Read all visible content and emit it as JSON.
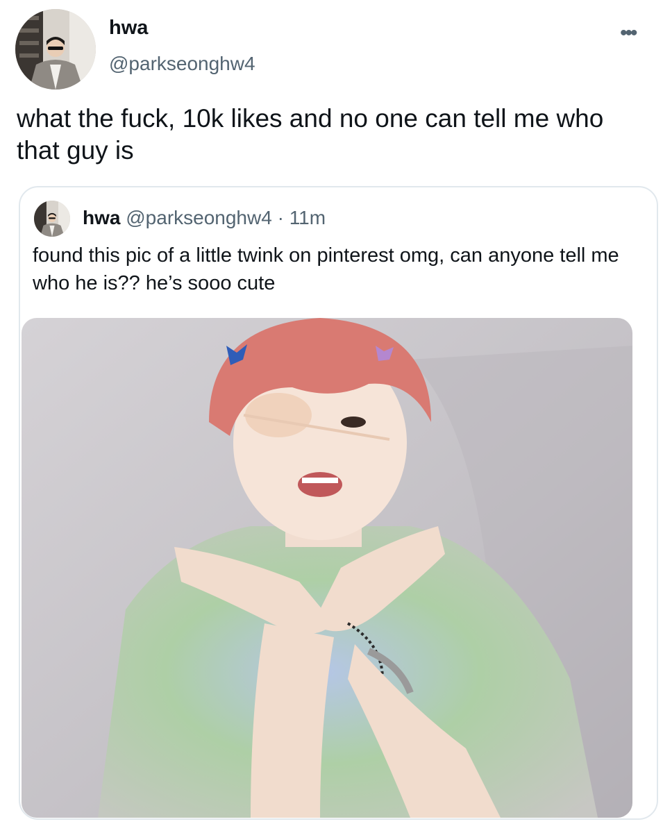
{
  "author": {
    "name": "hwa",
    "handle": "@parkseonghw4",
    "avatar_icon": "profile-photo-icon"
  },
  "tweet": {
    "text": "what the fuck, 10k likes and no one can tell me who that guy is",
    "more_icon": "more-options-icon"
  },
  "quote": {
    "name": "hwa",
    "handle": "@parkseonghw4",
    "separator": "·",
    "time": "11m",
    "text": "found this pic of a little twink on pinterest omg, can anyone tell me who he is?? he’s sooo cute"
  },
  "colors": {
    "text_primary": "#0f1419",
    "text_secondary": "#536471",
    "border": "#e1e8ed",
    "background": "#ffffff"
  }
}
